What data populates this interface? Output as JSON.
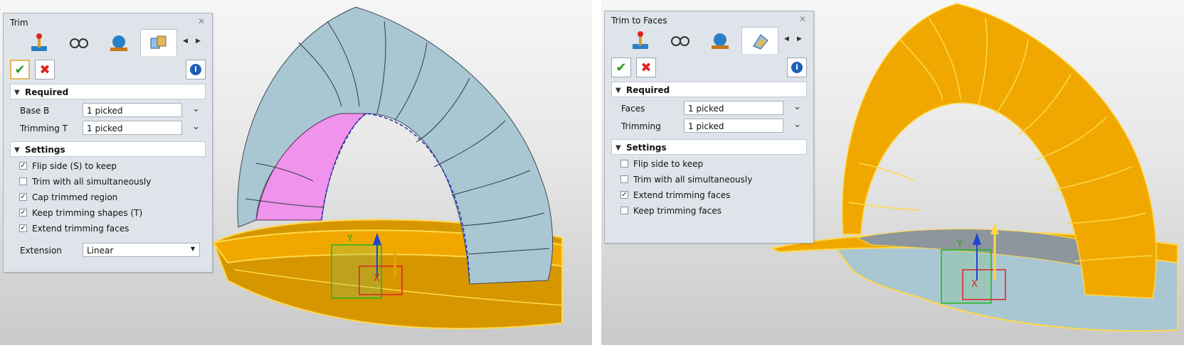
{
  "left": {
    "title": "Trim",
    "tabs": [
      {
        "icon": "joystick-icon"
      },
      {
        "icon": "glasses-icon"
      },
      {
        "icon": "globe-icon"
      },
      {
        "icon": "boxes-icon",
        "active": true
      }
    ],
    "required_label": "Required",
    "fields": [
      {
        "label": "Base B",
        "value": "1 picked"
      },
      {
        "label": "Trimming T",
        "value": "1 picked"
      }
    ],
    "settings_label": "Settings",
    "checks": [
      {
        "label": "Flip side (S) to keep",
        "checked": true
      },
      {
        "label": "Trim with all simultaneously",
        "checked": false
      },
      {
        "label": "Cap trimmed region",
        "checked": true
      },
      {
        "label": "Keep trimming shapes (T)",
        "checked": true
      },
      {
        "label": "Extend trimming faces",
        "checked": true
      }
    ],
    "extension_label": "Extension",
    "extension_value": "Linear",
    "check_mark": "✓"
  },
  "right": {
    "title": "Trim to Faces",
    "tabs": [
      {
        "icon": "joystick-icon"
      },
      {
        "icon": "glasses-icon"
      },
      {
        "icon": "globe-icon"
      },
      {
        "icon": "face-trim-icon",
        "active": true
      }
    ],
    "required_label": "Required",
    "fields": [
      {
        "label": "Faces",
        "value": "1 picked"
      },
      {
        "label": "Trimming",
        "value": "1 picked"
      }
    ],
    "settings_label": "Settings",
    "checks": [
      {
        "label": "Flip side to keep",
        "checked": false
      },
      {
        "label": "Trim with all simultaneously",
        "checked": false
      },
      {
        "label": "Extend trimming faces",
        "checked": true
      },
      {
        "label": "Keep trimming faces",
        "checked": false
      }
    ],
    "check_mark": "✓"
  },
  "axes": {
    "x": "X",
    "y": "Y"
  },
  "colors": {
    "panel_bg": "#dfe4ea",
    "model_blue": "#a9c6d3",
    "model_gold": "#f0a800",
    "trim_face": "#ef93ec",
    "edge_highlight": "#ffd84a"
  }
}
